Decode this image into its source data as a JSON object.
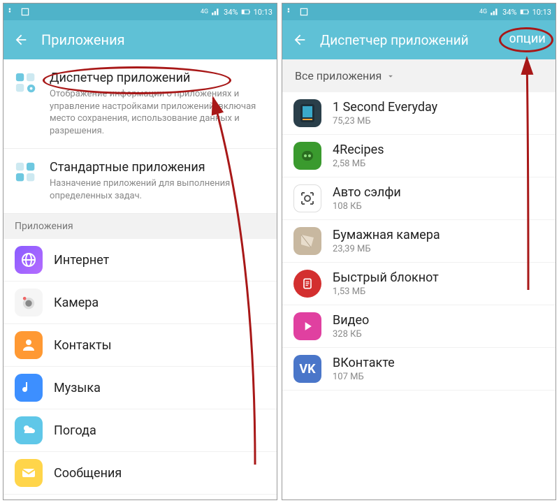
{
  "status": {
    "network": "4G",
    "battery_pct": "34%",
    "time": "10:13"
  },
  "left": {
    "title": "Приложения",
    "sections": [
      {
        "title": "Диспетчер приложений",
        "desc": "Отображение информации о приложениях и управление настройками приложений, включая место сохранения, использование данных и разрешения."
      },
      {
        "title": "Стандартные приложения",
        "desc": "Назначение приложений для выполнения определенных задач."
      }
    ],
    "subhead": "Приложения",
    "apps": [
      {
        "label": "Интернет"
      },
      {
        "label": "Камера"
      },
      {
        "label": "Контакты"
      },
      {
        "label": "Музыка"
      },
      {
        "label": "Погода"
      },
      {
        "label": "Сообщения"
      }
    ]
  },
  "right": {
    "title": "Диспетчер приложений",
    "action": "ОПЦИИ",
    "filter": "Все приложения",
    "apps": [
      {
        "label": "1 Second Everyday",
        "size": "75,23 МБ"
      },
      {
        "label": "4Recipes",
        "size": "2,58 МБ"
      },
      {
        "label": "Авто сэлфи",
        "size": "108 КБ"
      },
      {
        "label": "Бумажная камера",
        "size": "23,39 МБ"
      },
      {
        "label": "Быстрый блокнот",
        "size": "1,53 МБ"
      },
      {
        "label": "Видео",
        "size": "328 КБ"
      },
      {
        "label": "ВКонтакте",
        "size": "107 МБ"
      }
    ]
  }
}
